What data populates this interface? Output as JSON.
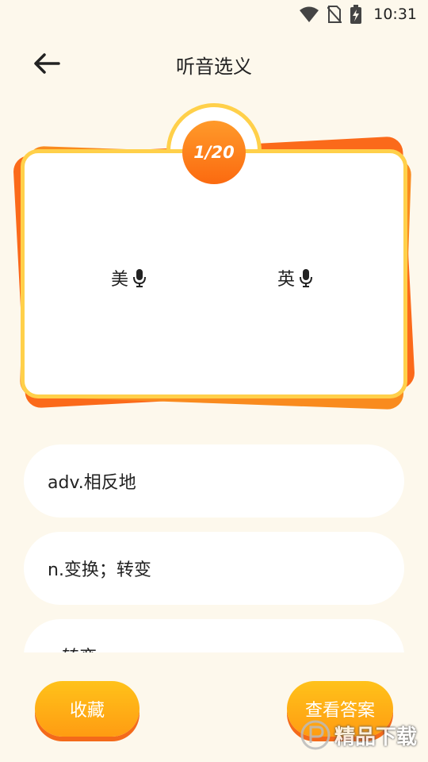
{
  "status_bar": {
    "time": "10:31"
  },
  "header": {
    "title": "听音选义"
  },
  "card": {
    "counter": "1/20",
    "us_label": "美",
    "uk_label": "英"
  },
  "options": [
    {
      "text": "adv.相反地"
    },
    {
      "text": "n.变换；转变"
    },
    {
      "text": "v.转变"
    }
  ],
  "buttons": {
    "collect": "收藏",
    "answer": "查看答案"
  },
  "watermark": {
    "text": "精品下载"
  },
  "colors": {
    "background": "#fdf8ec",
    "accent_orange": "#fb6a10",
    "accent_yellow": "#ffd04a"
  }
}
